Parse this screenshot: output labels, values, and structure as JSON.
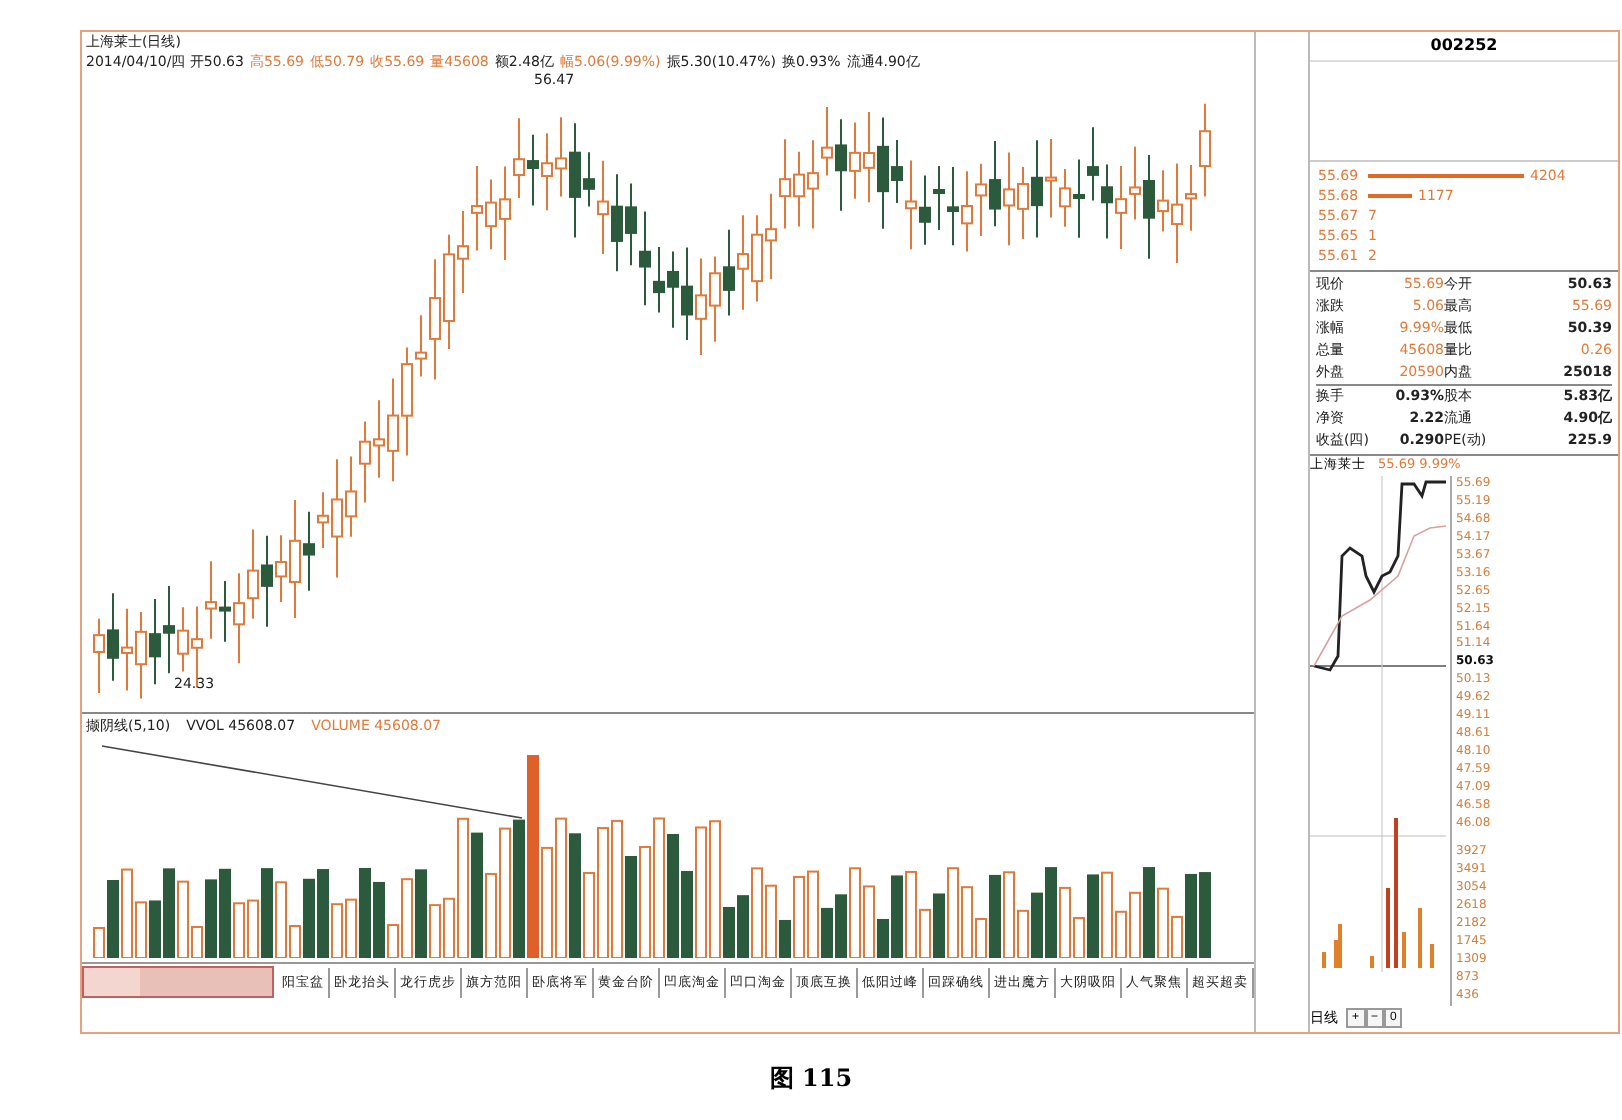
{
  "chart_title": "上海莱士(日线)",
  "quote_line": [
    {
      "text": "2014/04/10/四 开50.63",
      "hot": false
    },
    {
      "text": "高55.69",
      "hot": true
    },
    {
      "text": "低50.79",
      "hot": true
    },
    {
      "text": "收55.69",
      "hot": true
    },
    {
      "text": "量45608",
      "hot": true
    },
    {
      "text": "额2.48亿",
      "hot": false
    },
    {
      "text": "幅5.06(9.99%)",
      "hot": true
    },
    {
      "text": "振5.30(10.47%)",
      "hot": false
    },
    {
      "text": "换0.93%",
      "hot": false
    },
    {
      "text": "流通4.90亿",
      "hot": false
    }
  ],
  "high_label": "56.47",
  "low_label": "24.33",
  "volume_header": [
    {
      "text": "撷阴线(5,10)",
      "hot": false
    },
    {
      "text": "VVOL 45608.07",
      "hot": false
    },
    {
      "text": "VOLUME 45608.07",
      "hot": true
    }
  ],
  "bottom_tabs": [
    {
      "label": "阳宝盆",
      "selected": false
    },
    {
      "label": "卧龙抬头",
      "selected": false
    },
    {
      "label": "龙行虎步",
      "selected": false
    },
    {
      "label": "旗方范阳",
      "selected": false
    },
    {
      "label": "卧底将军",
      "selected": false
    },
    {
      "label": "黄金台阶",
      "selected": false
    },
    {
      "label": "凹底淘金",
      "selected": false
    },
    {
      "label": "凹口淘金",
      "selected": false
    },
    {
      "label": "顶底互换",
      "selected": false
    },
    {
      "label": "低阳过峰",
      "selected": false
    },
    {
      "label": "回踩确线",
      "selected": false
    },
    {
      "label": "进出魔方",
      "selected": false
    },
    {
      "label": "大阴吸阳",
      "selected": false
    },
    {
      "label": "人气聚焦",
      "selected": false
    },
    {
      "label": "超买超卖",
      "selected": false
    }
  ],
  "stock_code": "002252",
  "order_book": [
    {
      "price": "55.69",
      "volume": "4204"
    },
    {
      "price": "55.68",
      "volume": "1177"
    },
    {
      "price": "55.67",
      "volume": "7"
    },
    {
      "price": "55.65",
      "volume": "1"
    },
    {
      "price": "55.61",
      "volume": "2"
    }
  ],
  "stats": [
    [
      {
        "text": "现价",
        "kind": "label"
      },
      {
        "text": "55.69",
        "kind": "up"
      },
      {
        "text": "今开",
        "kind": "label"
      },
      {
        "text": "50.63",
        "kind": "plain"
      }
    ],
    [
      {
        "text": "涨跌",
        "kind": "label"
      },
      {
        "text": "5.06",
        "kind": "up"
      },
      {
        "text": "最高",
        "kind": "label"
      },
      {
        "text": "55.69",
        "kind": "up"
      }
    ],
    [
      {
        "text": "涨幅",
        "kind": "label"
      },
      {
        "text": "9.99%",
        "kind": "up"
      },
      {
        "text": "最低",
        "kind": "label"
      },
      {
        "text": "50.39",
        "kind": "plain"
      }
    ],
    [
      {
        "text": "总量",
        "kind": "label"
      },
      {
        "text": "45608",
        "kind": "up"
      },
      {
        "text": "量比",
        "kind": "label"
      },
      {
        "text": "0.26",
        "kind": "up"
      }
    ],
    [
      {
        "text": "外盘",
        "kind": "label"
      },
      {
        "text": "20590",
        "kind": "up"
      },
      {
        "text": "内盘",
        "kind": "label"
      },
      {
        "text": "25018",
        "kind": "plain"
      }
    ],
    [
      {
        "text": "换手",
        "kind": "label"
      },
      {
        "text": "0.93%",
        "kind": "plain"
      },
      {
        "text": "股本",
        "kind": "label"
      },
      {
        "text": "5.83亿",
        "kind": "plain"
      }
    ],
    [
      {
        "text": "净资",
        "kind": "label"
      },
      {
        "text": "2.22",
        "kind": "plain"
      },
      {
        "text": "流通",
        "kind": "label"
      },
      {
        "text": "4.90亿",
        "kind": "plain"
      }
    ],
    [
      {
        "text": "收益(四)",
        "kind": "label"
      },
      {
        "text": "0.290",
        "kind": "plain"
      },
      {
        "text": "PE(动)",
        "kind": "label"
      },
      {
        "text": "225.9",
        "kind": "plain"
      }
    ]
  ],
  "intraday": {
    "name": "上海莱士",
    "quote": "55.69 9.99%",
    "price_ticks": [
      "55.69",
      "55.19",
      "54.68",
      "54.17",
      "53.67",
      "53.16",
      "52.65",
      "52.15",
      "51.64",
      "51.14",
      "50.63",
      "50.13",
      "49.62",
      "49.11",
      "48.61",
      "48.10",
      "47.59",
      "47.09",
      "46.58",
      "46.08"
    ],
    "volume_ticks": [
      "3927",
      "3491",
      "3054",
      "2618",
      "2182",
      "1745",
      "1309",
      "873",
      "436"
    ]
  },
  "period_label": "日线",
  "zoom_buttons": [
    "+",
    "−",
    "0"
  ],
  "caption": "图 115"
}
